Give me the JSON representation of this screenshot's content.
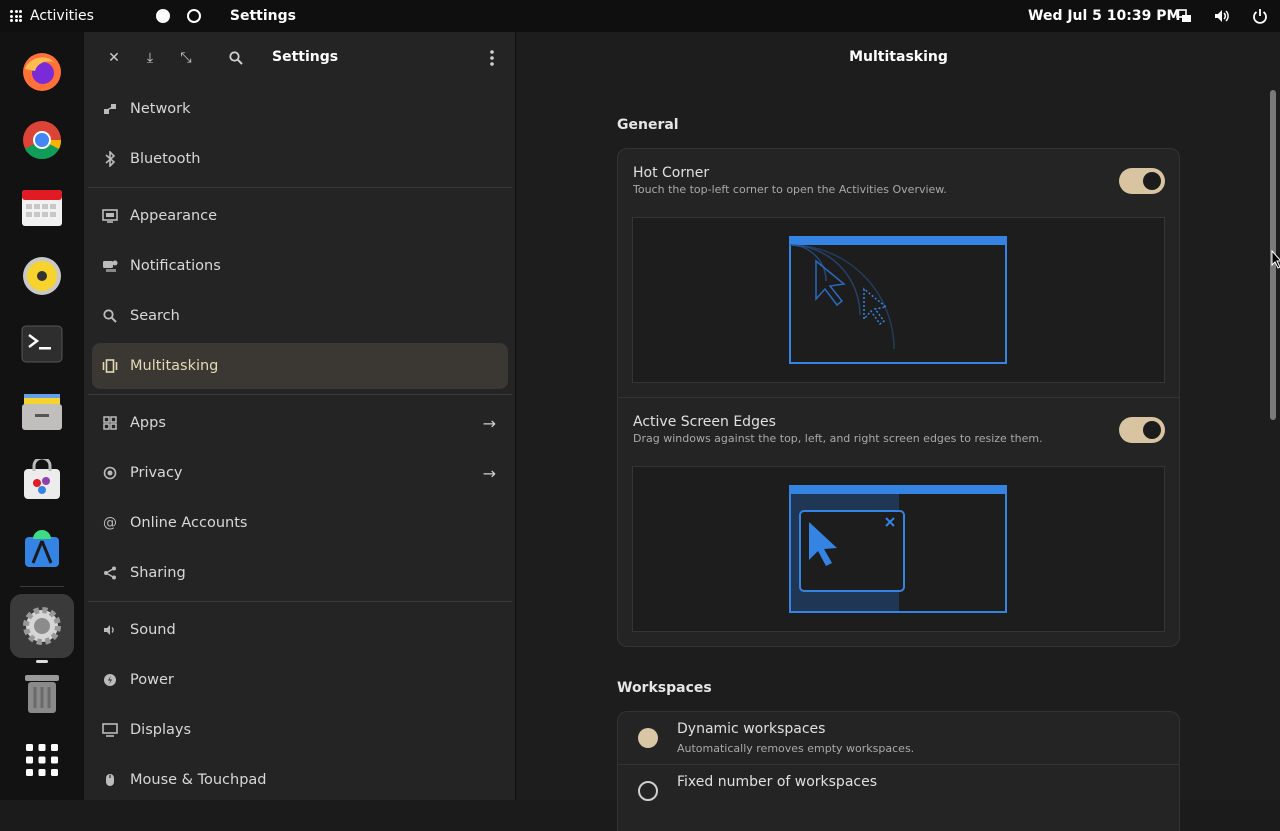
{
  "topbar": {
    "activities": "Activities",
    "app_name": "Settings",
    "clock": "Wed Jul 5  10:39 PM"
  },
  "dock": {
    "items": [
      "firefox-icon",
      "chrome-icon",
      "calendar-icon",
      "rhythmbox-icon",
      "terminal-icon",
      "files-icon",
      "software-icon",
      "android-studio-icon",
      "settings-icon",
      "trash-icon",
      "app-grid-icon"
    ]
  },
  "sidebar": {
    "title": "Settings",
    "items": [
      {
        "label": "Network",
        "icon": "network-icon"
      },
      {
        "label": "Bluetooth",
        "icon": "bluetooth-icon"
      },
      {
        "label": "Appearance",
        "icon": "appearance-icon"
      },
      {
        "label": "Notifications",
        "icon": "notifications-icon"
      },
      {
        "label": "Search",
        "icon": "search-icon"
      },
      {
        "label": "Multitasking",
        "icon": "multitasking-icon"
      },
      {
        "label": "Apps",
        "icon": "apps-icon"
      },
      {
        "label": "Privacy",
        "icon": "privacy-icon"
      },
      {
        "label": "Online Accounts",
        "icon": "online-accounts-icon"
      },
      {
        "label": "Sharing",
        "icon": "sharing-icon"
      },
      {
        "label": "Sound",
        "icon": "sound-icon"
      },
      {
        "label": "Power",
        "icon": "power-icon"
      },
      {
        "label": "Displays",
        "icon": "displays-icon"
      },
      {
        "label": "Mouse & Touchpad",
        "icon": "mouse-icon"
      }
    ]
  },
  "main": {
    "title": "Multitasking",
    "general": {
      "heading": "General",
      "hot_corner": {
        "title": "Hot Corner",
        "subtitle": "Touch the top-left corner to open the Activities Overview.",
        "enabled": true
      },
      "screen_edges": {
        "title": "Active Screen Edges",
        "subtitle": "Drag windows against the top, left, and right screen edges to resize them.",
        "enabled": true
      }
    },
    "workspaces": {
      "heading": "Workspaces",
      "dynamic": {
        "title": "Dynamic workspaces",
        "subtitle": "Automatically removes empty workspaces.",
        "selected": true
      },
      "fixed": {
        "title": "Fixed number of workspaces",
        "selected": false
      }
    }
  },
  "colors": {
    "accent": "#d8c4a0",
    "illustration_blue": "#3584e4"
  }
}
